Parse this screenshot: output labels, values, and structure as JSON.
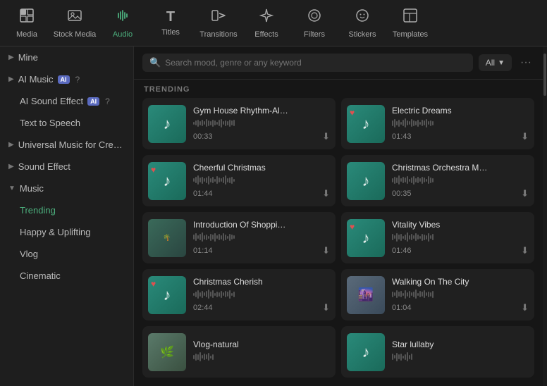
{
  "topNav": {
    "items": [
      {
        "id": "media",
        "label": "Media",
        "icon": "⬛",
        "active": false
      },
      {
        "id": "stock-media",
        "label": "Stock Media",
        "icon": "🎞",
        "active": false
      },
      {
        "id": "audio",
        "label": "Audio",
        "icon": "🎵",
        "active": true
      },
      {
        "id": "titles",
        "label": "Titles",
        "icon": "T",
        "active": false
      },
      {
        "id": "transitions",
        "label": "Transitions",
        "icon": "▶",
        "active": false
      },
      {
        "id": "effects",
        "label": "Effects",
        "icon": "✦",
        "active": false
      },
      {
        "id": "filters",
        "label": "Filters",
        "icon": "◎",
        "active": false
      },
      {
        "id": "stickers",
        "label": "Stickers",
        "icon": "☺",
        "active": false
      },
      {
        "id": "templates",
        "label": "Templates",
        "icon": "⊞",
        "active": false
      }
    ]
  },
  "sidebar": {
    "items": [
      {
        "id": "mine",
        "label": "Mine",
        "type": "chevron",
        "badge": null
      },
      {
        "id": "ai-music",
        "label": "AI Music",
        "type": "chevron",
        "badge": "AI"
      },
      {
        "id": "ai-sound-effect",
        "label": "AI Sound Effect",
        "type": "plain",
        "badge": "AI"
      },
      {
        "id": "text-to-speech",
        "label": "Text to Speech",
        "type": "plain",
        "badge": null
      },
      {
        "id": "universal-music",
        "label": "Universal Music for Cre…",
        "type": "chevron",
        "badge": null
      },
      {
        "id": "sound-effect",
        "label": "Sound Effect",
        "type": "chevron",
        "badge": null
      },
      {
        "id": "music",
        "label": "Music",
        "type": "group",
        "badge": null
      },
      {
        "id": "trending",
        "label": "Trending",
        "type": "sub-active"
      },
      {
        "id": "happy-uplifting",
        "label": "Happy & Uplifting",
        "type": "sub"
      },
      {
        "id": "vlog",
        "label": "Vlog",
        "type": "sub"
      },
      {
        "id": "cinematic",
        "label": "Cinematic",
        "type": "sub"
      }
    ]
  },
  "search": {
    "placeholder": "Search mood, genre or any keyword",
    "filter_label": "All"
  },
  "trending_label": "TRENDING",
  "musicCards": [
    {
      "id": "gym-house",
      "title": "Gym House Rhythm-Al…",
      "duration": "00:33",
      "thumbType": "teal",
      "hasHeart": false
    },
    {
      "id": "electric-dreams",
      "title": "Electric Dreams",
      "duration": "01:43",
      "thumbType": "teal",
      "hasHeart": true
    },
    {
      "id": "cheerful-christmas",
      "title": "Cheerful Christmas",
      "duration": "01:44",
      "thumbType": "teal",
      "hasHeart": true
    },
    {
      "id": "christmas-orchestra",
      "title": "Christmas Orchestra M…",
      "duration": "00:35",
      "thumbType": "teal",
      "hasHeart": false
    },
    {
      "id": "introduction-shoppi",
      "title": "Introduction Of Shoppi…",
      "duration": "01:14",
      "thumbType": "photo1",
      "hasHeart": false
    },
    {
      "id": "vitality-vibes",
      "title": "Vitality Vibes",
      "duration": "01:46",
      "thumbType": "teal",
      "hasHeart": true
    },
    {
      "id": "christmas-cherish",
      "title": "Christmas Cherish",
      "duration": "02:44",
      "thumbType": "teal",
      "hasHeart": true
    },
    {
      "id": "walking-on-the-city",
      "title": "Walking On The City",
      "duration": "01:04",
      "thumbType": "photo2",
      "hasHeart": false
    },
    {
      "id": "vlog-natural",
      "title": "Vlog-natural",
      "duration": "",
      "thumbType": "photo3",
      "hasHeart": false
    },
    {
      "id": "star-lullaby",
      "title": "Star lullaby",
      "duration": "",
      "thumbType": "teal",
      "hasHeart": false
    }
  ]
}
